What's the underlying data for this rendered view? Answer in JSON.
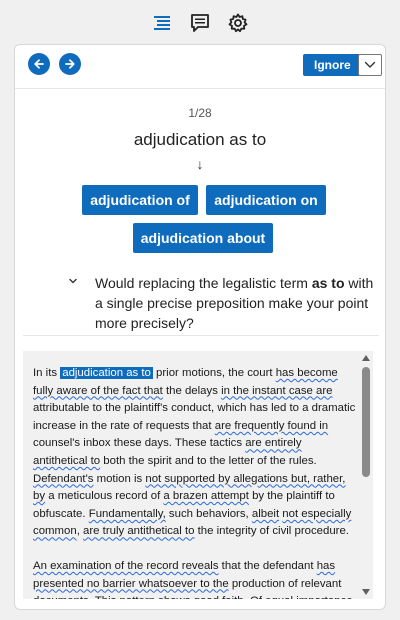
{
  "topbar": {
    "icons": [
      "list-icon",
      "comment-icon",
      "gear-icon"
    ]
  },
  "nav": {
    "prev_icon": "arrow-left-icon",
    "next_icon": "arrow-right-icon",
    "ignore_label": "Ignore",
    "dropdown_icon": "chevron-down-icon"
  },
  "card": {
    "counter": "1/28",
    "phrase": "adjudication as to",
    "arrow": "↓",
    "suggestions": [
      "adjudication of",
      "adjudication on",
      "adjudication about"
    ],
    "question_pre": "Would replacing the legalistic term ",
    "question_term": "as to",
    "question_post": " with a single precise preposition make your point more precisely?"
  },
  "doc": {
    "p1": [
      {
        "t": "In its "
      },
      {
        "t": "adjudication as to",
        "s": "hl"
      },
      {
        "t": " prior motions, the court "
      },
      {
        "t": "has become fully aware of the fact that",
        "s": "sq"
      },
      {
        "t": " the delays "
      },
      {
        "t": "in the instant case are",
        "s": "sq"
      },
      {
        "t": " attributable to the plaintiff's conduct, which has led to a dramatic increase in the rate of requests that "
      },
      {
        "t": "are frequently found in",
        "s": "sq"
      },
      {
        "t": " counsel's inbox these days. These tactics "
      },
      {
        "t": "are entirely antithetical to",
        "s": "sq"
      },
      {
        "t": " both the spirit and to the letter of the rules. "
      },
      {
        "t": "Defendant's",
        "s": "sq"
      },
      {
        "t": " motion is "
      },
      {
        "t": "not supported by allegations but, rather, by",
        "s": "sq"
      },
      {
        "t": " a meticulous record of "
      },
      {
        "t": "a brazen attempt",
        "s": "sq"
      },
      {
        "t": " by the plaintiff to obfuscate. "
      },
      {
        "t": "Fundamentally,",
        "s": "sq"
      },
      {
        "t": " such behaviors, "
      },
      {
        "t": "albeit",
        "s": "sq"
      },
      {
        "t": " "
      },
      {
        "t": "not especially common",
        "s": "sq"
      },
      {
        "t": ", "
      },
      {
        "t": "are truly antithetical to",
        "s": "sq"
      },
      {
        "t": " the integrity of civil procedure."
      }
    ],
    "p2": [
      {
        "t": "An examination of the record reveals",
        "s": "sq"
      },
      {
        "t": " that the defendant "
      },
      {
        "t": "has presented no barrier whatsoever to the",
        "s": "sq"
      },
      {
        "t": " production of relevant documents. This pattern shows good faith. Of equal importance"
      }
    ]
  },
  "colors": {
    "accent": "#0f6cbd",
    "squiggle": "#2b6ad6",
    "doc_bg": "#f1f1f1"
  }
}
